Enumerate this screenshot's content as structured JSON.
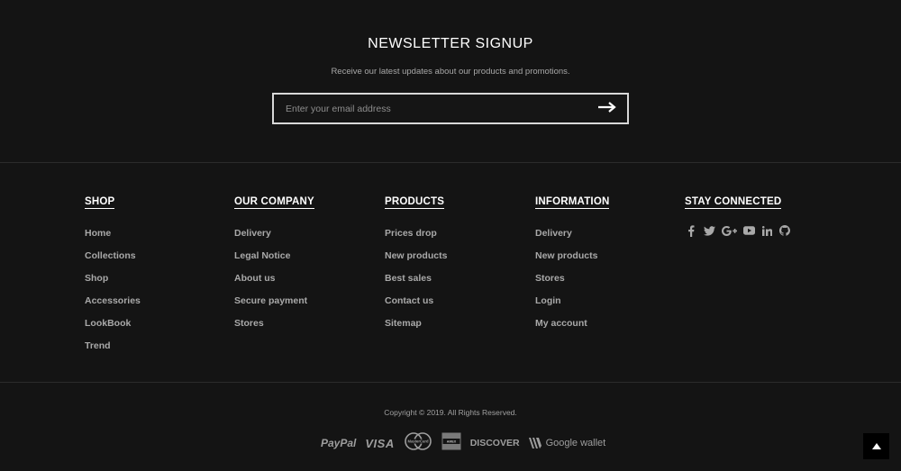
{
  "newsletter": {
    "title": "NEWSLETTER SIGNUP",
    "subtitle": "Receive our latest updates about our products and promotions.",
    "email_placeholder": "Enter your email address",
    "submit_icon": "arrow-right-icon"
  },
  "footer": {
    "columns": [
      {
        "title": "SHOP",
        "links": [
          "Home",
          "Collections",
          "Shop",
          "Accessories",
          "LookBook",
          "Trend"
        ]
      },
      {
        "title": "OUR COMPANY",
        "links": [
          "Delivery",
          "Legal Notice",
          "About us",
          "Secure payment",
          "Stores"
        ]
      },
      {
        "title": "PRODUCTS",
        "links": [
          "Prices drop",
          "New products",
          "Best sales",
          "Contact us",
          "Sitemap"
        ]
      },
      {
        "title": "INFORMATION",
        "links": [
          "Delivery",
          "New products",
          "Stores",
          "Login",
          "My account"
        ]
      },
      {
        "title": "STAY CONNECTED",
        "social": [
          "facebook-icon",
          "twitter-icon",
          "google-plus-icon",
          "youtube-icon",
          "linkedin-icon",
          "github-icon"
        ]
      }
    ]
  },
  "bottom": {
    "copyright": "Copyright © 2019. All Rights Reserved.",
    "payments": {
      "paypal": "PayPal",
      "visa": "VISA",
      "mastercard": "MasterCard",
      "amex": "AMERICAN EXPRESS",
      "discover": "DISCOVER",
      "google_wallet": "Google wallet"
    },
    "back_to_top_icon": "caret-up-icon"
  },
  "colors": {
    "background": "#141414",
    "heading": "#ffffff",
    "link": "#a9a9a9",
    "border": "#d8d8d8"
  }
}
